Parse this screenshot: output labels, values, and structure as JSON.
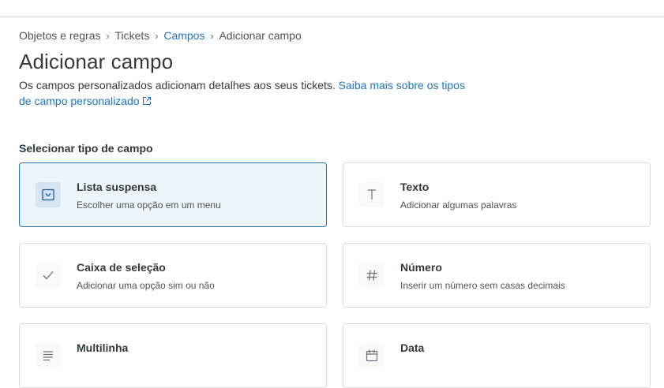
{
  "breadcrumb": {
    "items": [
      {
        "label": "Objetos e regras"
      },
      {
        "label": "Tickets"
      },
      {
        "label": "Campos"
      },
      {
        "label": "Adicionar campo"
      }
    ]
  },
  "page": {
    "title": "Adicionar campo",
    "description": "Os campos personalizados adicionam detalhes aos seus tickets.",
    "learn_more_link": "Saiba mais sobre os tipos de campo personalizado"
  },
  "section": {
    "label": "Selecionar tipo de campo"
  },
  "field_types": [
    {
      "title": "Lista suspensa",
      "subtitle": "Escolher uma opção em um menu",
      "icon": "dropdown-icon",
      "selected": true
    },
    {
      "title": "Texto",
      "subtitle": "Adicionar algumas palavras",
      "icon": "text-icon",
      "selected": false
    },
    {
      "title": "Caixa de seleção",
      "subtitle": "Adicionar uma opção sim ou não",
      "icon": "checkmark-icon",
      "selected": false
    },
    {
      "title": "Número",
      "subtitle": "Inserir um número sem casas decimais",
      "icon": "hash-icon",
      "selected": false
    },
    {
      "title": "Multilinha",
      "subtitle": "",
      "icon": "multiline-icon",
      "selected": false
    },
    {
      "title": "Data",
      "subtitle": "",
      "icon": "calendar-icon",
      "selected": false
    }
  ],
  "colors": {
    "link": "#1f73b7",
    "selected_background": "#edf4fb",
    "selected_border": "#1f73b7",
    "card_border": "#d8dcde"
  }
}
